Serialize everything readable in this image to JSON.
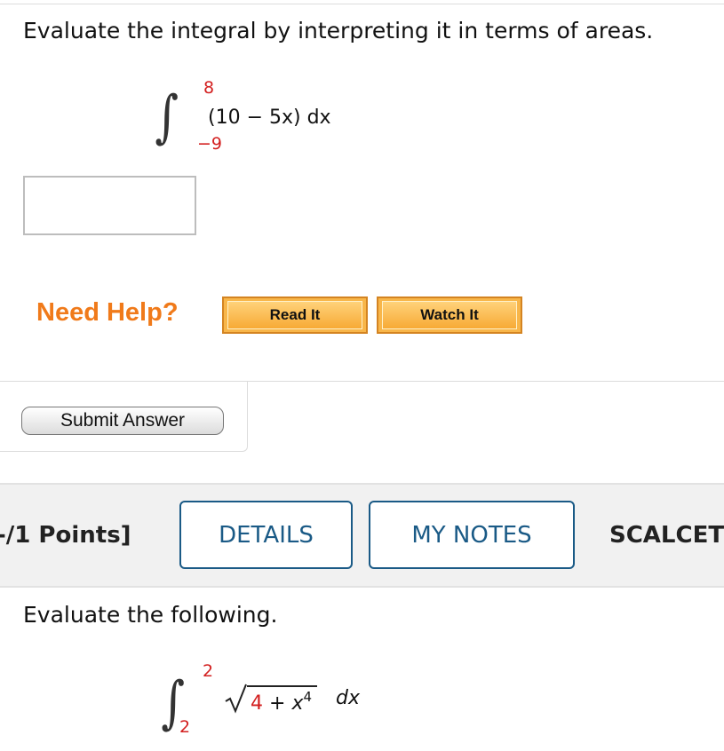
{
  "problem1": {
    "prompt": "Evaluate the integral by interpreting it in terms of areas.",
    "upper_limit": "8",
    "lower_limit": "−9",
    "integrand": "(10 − 5x) dx",
    "answer_value": ""
  },
  "help": {
    "label": "Need Help?",
    "read_it": "Read It",
    "watch_it": "Watch It"
  },
  "submit": {
    "label": "Submit Answer"
  },
  "problem2_header": {
    "points": "-/1 Points]",
    "details": "DETAILS",
    "my_notes": "MY NOTES",
    "source": "SCALCET"
  },
  "problem2": {
    "prompt": "Evaluate the following.",
    "upper_limit": "2",
    "lower_limit": "2",
    "radicand_const": "4",
    "radicand_op": "+",
    "radicand_var": "x",
    "radicand_exp": "4",
    "differential": "dx"
  },
  "colors": {
    "limit_red": "#d32020",
    "help_orange": "#f07a1a",
    "button_orange": "#f8b64a",
    "tab_blue": "#1a5a86"
  }
}
